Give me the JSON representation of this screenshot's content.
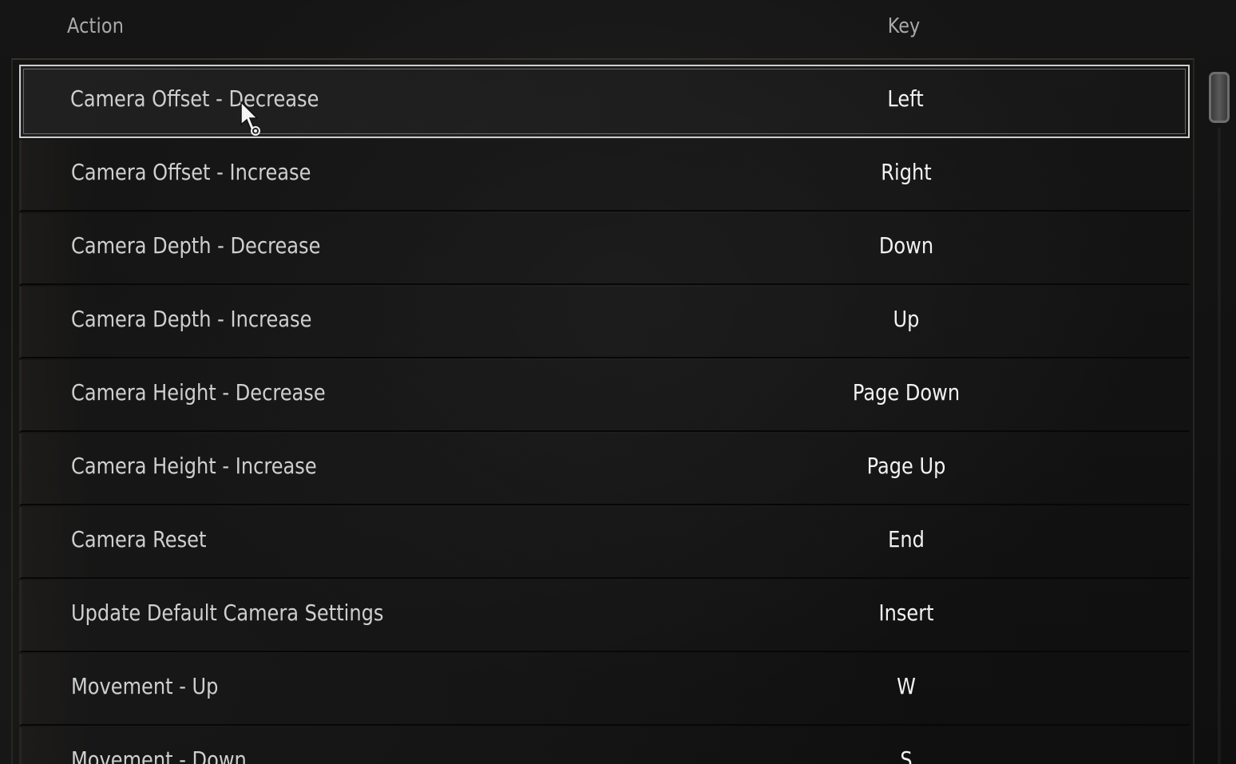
{
  "header": {
    "action_label": "Action",
    "key_label": "Key"
  },
  "bindings": [
    {
      "action": "Camera Offset - Decrease",
      "key": "Left"
    },
    {
      "action": "Camera Offset - Increase",
      "key": "Right"
    },
    {
      "action": "Camera Depth - Decrease",
      "key": "Down"
    },
    {
      "action": "Camera Depth - Increase",
      "key": "Up"
    },
    {
      "action": "Camera Height - Decrease",
      "key": "Page Down"
    },
    {
      "action": "Camera Height - Increase",
      "key": "Page Up"
    },
    {
      "action": "Camera Reset",
      "key": "End"
    },
    {
      "action": "Update Default Camera Settings",
      "key": "Insert"
    },
    {
      "action": "Movement - Up",
      "key": "W"
    },
    {
      "action": "Movement - Down",
      "key": "S"
    }
  ],
  "selected_index": 0,
  "colors": {
    "selection_border": "#cfcfcf",
    "action_text": "#cfcfcf",
    "key_text": "#f2f2f2",
    "header_text": "#a9a9a9"
  },
  "icons": {
    "cursor": "mouse-pointer-icon"
  }
}
